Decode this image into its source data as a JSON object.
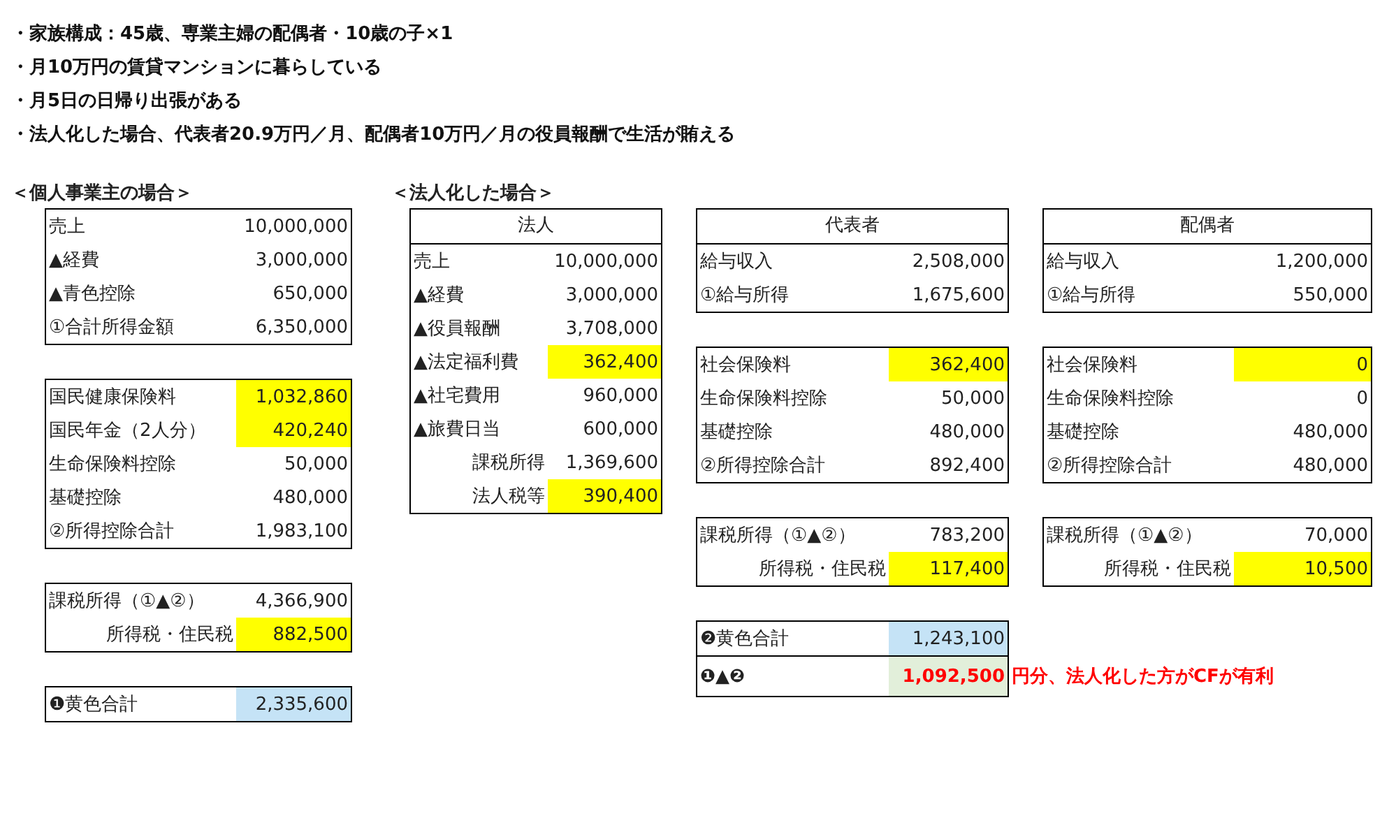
{
  "notes": [
    "・家族構成：45歳、専業主婦の配偶者・10歳の子×1",
    "・月10万円の賃貸マンションに暮らしている",
    "・月5日の日帰り出張がある",
    "・法人化した場合、代表者20.9万円／月、配偶者10万円／月の役員報酬で生活が賄える"
  ],
  "sections": [
    {
      "title": "＜個人事業主の場合＞",
      "columns": [
        {
          "tables": [
            {
              "rows": [
                {
                  "label": "売上",
                  "value": "10,000,000",
                  "kind": "plain"
                },
                {
                  "label": "▲経費",
                  "value": "3,000,000",
                  "kind": "plain"
                },
                {
                  "label": "▲青色控除",
                  "value": "650,000",
                  "kind": "plain"
                },
                {
                  "label": "①合計所得金額",
                  "value": "6,350,000",
                  "kind": "plain"
                }
              ]
            },
            {
              "rows": [
                {
                  "label": "国民健康保険料",
                  "value": "1,032,860",
                  "kind": "yellow"
                },
                {
                  "label": "国民年金（2人分）",
                  "value": "420,240",
                  "kind": "yellow"
                },
                {
                  "label": "生命保険料控除",
                  "value": "50,000",
                  "kind": "plain"
                },
                {
                  "label": "基礎控除",
                  "value": "480,000",
                  "kind": "plain"
                },
                {
                  "label": "②所得控除合計",
                  "value": "1,983,100",
                  "kind": "plain"
                }
              ]
            },
            {
              "rows": [
                {
                  "label": "課税所得（①▲②）",
                  "value": "4,366,900",
                  "kind": "plain"
                },
                {
                  "label": "所得税・住民税",
                  "value": "882,500",
                  "kind": "sub_yellow"
                }
              ]
            },
            {
              "rows": [
                {
                  "label": "❶黄色合計",
                  "value": "2,335,600",
                  "kind": "blue"
                }
              ]
            }
          ]
        }
      ]
    },
    {
      "title": "＜法人化した場合＞",
      "columns": [
        {
          "tables": [
            {
              "header": "法人",
              "rows": [
                {
                  "label": "売上",
                  "value": "10,000,000",
                  "kind": "plain"
                },
                {
                  "label": "▲経費",
                  "value": "3,000,000",
                  "kind": "plain"
                },
                {
                  "label": "▲役員報酬",
                  "value": "3,708,000",
                  "kind": "plain"
                },
                {
                  "label": "▲法定福利費",
                  "value": "362,400",
                  "kind": "yellow"
                },
                {
                  "label": "▲社宅費用",
                  "value": "960,000",
                  "kind": "plain"
                },
                {
                  "label": "▲旅費日当",
                  "value": "600,000",
                  "kind": "plain"
                },
                {
                  "label": "課税所得",
                  "value": "1,369,600",
                  "kind": "sub"
                },
                {
                  "label": "法人税等",
                  "value": "390,400",
                  "kind": "sub_yellow"
                }
              ]
            }
          ]
        },
        {
          "tables": [
            {
              "header": "代表者",
              "rows": [
                {
                  "label": "給与収入",
                  "value": "2,508,000",
                  "kind": "plain"
                },
                {
                  "label": "①給与所得",
                  "value": "1,675,600",
                  "kind": "plain"
                }
              ]
            },
            {
              "rows": [
                {
                  "label": "社会保険料",
                  "value": "362,400",
                  "kind": "yellow"
                },
                {
                  "label": "生命保険料控除",
                  "value": "50,000",
                  "kind": "plain"
                },
                {
                  "label": "基礎控除",
                  "value": "480,000",
                  "kind": "plain"
                },
                {
                  "label": "②所得控除合計",
                  "value": "892,400",
                  "kind": "plain"
                }
              ]
            },
            {
              "rows": [
                {
                  "label": "課税所得（①▲②）",
                  "value": "783,200",
                  "kind": "plain"
                },
                {
                  "label": "所得税・住民税",
                  "value": "117,400",
                  "kind": "sub_yellow"
                }
              ]
            },
            {
              "rows": [
                {
                  "label": "❷黄色合計",
                  "value": "1,243,100",
                  "kind": "blue"
                },
                {
                  "label": "❶▲❷",
                  "value": "1,092,500",
                  "kind": "result",
                  "note": "円分、法人化した方がCFが有利"
                }
              ]
            }
          ]
        },
        {
          "tables": [
            {
              "header": "配偶者",
              "rows": [
                {
                  "label": "給与収入",
                  "value": "1,200,000",
                  "kind": "plain"
                },
                {
                  "label": "①給与所得",
                  "value": "550,000",
                  "kind": "plain"
                }
              ]
            },
            {
              "rows": [
                {
                  "label": "社会保険料",
                  "value": "0",
                  "kind": "yellow"
                },
                {
                  "label": "生命保険料控除",
                  "value": "0",
                  "kind": "plain"
                },
                {
                  "label": "基礎控除",
                  "value": "480,000",
                  "kind": "plain"
                },
                {
                  "label": "②所得控除合計",
                  "value": "480,000",
                  "kind": "plain"
                }
              ]
            },
            {
              "rows": [
                {
                  "label": "課税所得（①▲②）",
                  "value": "70,000",
                  "kind": "plain"
                },
                {
                  "label": "所得税・住民税",
                  "value": "10,500",
                  "kind": "sub_yellow"
                }
              ]
            }
          ]
        }
      ]
    }
  ]
}
